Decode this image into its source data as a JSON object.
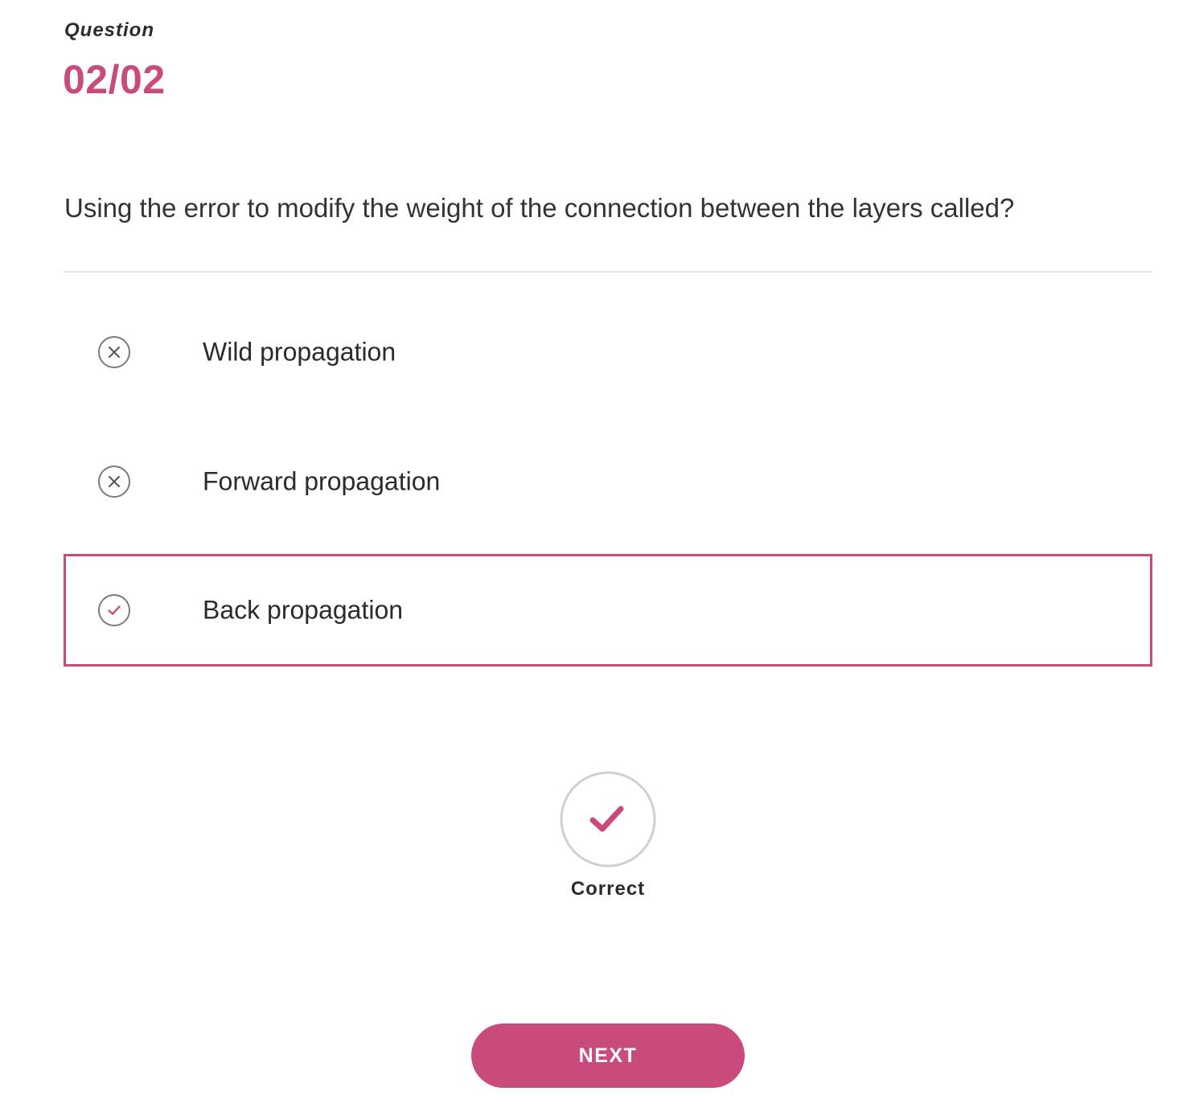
{
  "header": {
    "label": "Question",
    "counter": "02/02"
  },
  "question": {
    "text": "Using the error to modify the weight of the connection between the layers called?"
  },
  "options": [
    {
      "label": "Wild propagation",
      "icon": "x-circle-icon",
      "state": "incorrect"
    },
    {
      "label": "Forward propagation",
      "icon": "x-circle-icon",
      "state": "incorrect"
    },
    {
      "label": "Back propagation",
      "icon": "check-circle-icon",
      "state": "correct-selected"
    }
  ],
  "result": {
    "icon": "check-circle-icon",
    "label": "Correct"
  },
  "next_button": {
    "label": "NEXT"
  },
  "colors": {
    "accent": "#c94b7d",
    "icon_gray": "#7a7a7a",
    "ring_gray": "#d0d0d0",
    "text": "#2b2b2b",
    "divider": "#e6e6e6"
  }
}
